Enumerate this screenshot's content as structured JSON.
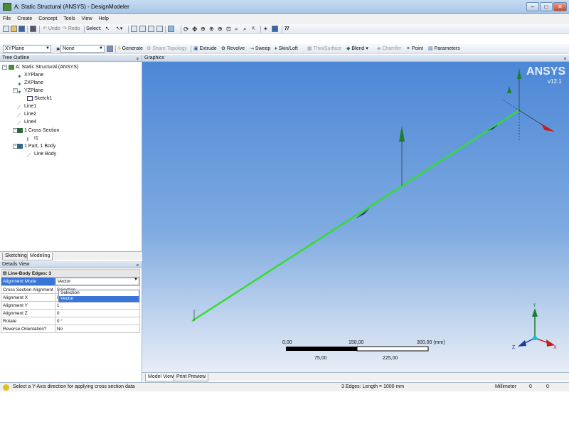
{
  "window": {
    "title": "A: Static Structural (ANSYS) - DesignModeler",
    "controls": [
      "–",
      "□",
      "✕"
    ]
  },
  "menu": [
    "File",
    "Create",
    "Concept",
    "Tools",
    "View",
    "Help"
  ],
  "toolbar1": {
    "undo": "Undo",
    "redo": "Redo",
    "select": "Select:"
  },
  "toolbar2": {
    "plane_combo": "XYPlane",
    "sketch_combo": "None",
    "generate": "Generate",
    "share_topology": "Share Topology",
    "extrude": "Extrude",
    "revolve": "Revolve",
    "sweep": "Sweep",
    "skin_loft": "Skin/Loft",
    "thin_surface": "Thin/Surface",
    "blend": "Blend",
    "chamfer": "Chamfer",
    "point": "Point",
    "parameters": "Parameters"
  },
  "tree": {
    "header": "Tree Outline",
    "pin": "ꟷ",
    "items": [
      {
        "label": "A: Static Structural (ANSYS)"
      },
      {
        "label": "XYPlane"
      },
      {
        "label": "ZXPlane"
      },
      {
        "label": "YZPlane"
      },
      {
        "label": "Sketch1"
      },
      {
        "label": "Line1"
      },
      {
        "label": "Line2"
      },
      {
        "label": "Line4"
      },
      {
        "label": "1 Cross Section"
      },
      {
        "label": "I1"
      },
      {
        "label": "1 Part, 1 Body"
      },
      {
        "label": "Line Body"
      }
    ]
  },
  "left_tabs": [
    "Sketching",
    "Modeling"
  ],
  "details": {
    "header": "Details View",
    "group": "Line-Body Edges: 3",
    "rows": [
      {
        "key": "Alignment Mode",
        "value": "Vector"
      },
      {
        "key": "Cross Section Alignment",
        "value": "Selection"
      },
      {
        "key": "Alignment X",
        "value": "0"
      },
      {
        "key": "Alignment Y",
        "value": "1"
      },
      {
        "key": "Alignment Z",
        "value": "0"
      },
      {
        "key": "Rotate",
        "value": "0 °"
      },
      {
        "key": "Reverse Orientation?",
        "value": "No"
      }
    ],
    "dropdown_options": [
      "Selection",
      "Vector"
    ],
    "dropdown_selected": "Vector"
  },
  "graphics": {
    "header": "Graphics",
    "logo": "ANSYS",
    "version": "v12.1",
    "scale": {
      "top_labels": [
        "0,00",
        "150,00",
        "300,00 (mm)"
      ],
      "bottom_labels": [
        "75,00",
        "225,00"
      ]
    },
    "triad": {
      "x": "X",
      "y": "Y",
      "z": "Z"
    }
  },
  "graphics_tabs": [
    "Model View",
    "Print Preview"
  ],
  "status": {
    "message": "Select a Y-Axis direction for applying cross section data",
    "selection": "3 Edges: Length = 1000 mm",
    "units": "Millimeter",
    "v1": "0",
    "v2": "0"
  },
  "colors": {
    "line": "#33dd33",
    "background_top": "#4a86d6",
    "background_bottom": "#e8eef6",
    "accent": "#3875d7"
  }
}
